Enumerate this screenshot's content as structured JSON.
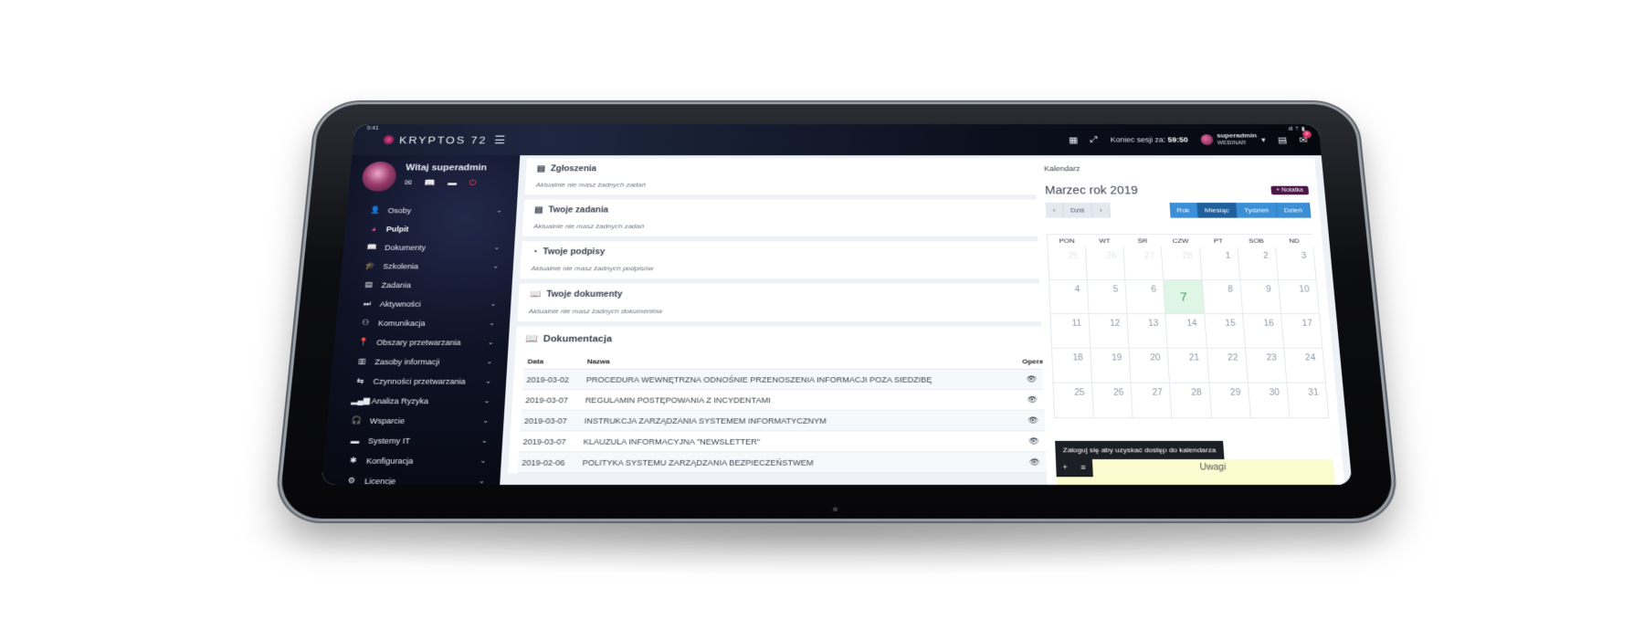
{
  "status": {
    "time": "9:41",
    "right": "ıll ⇡ ▮"
  },
  "topbar": {
    "logo": "KRYPTOS 72",
    "session_label": "Koniec sesji za:",
    "session_time": "59:50",
    "user_name": "superadmin",
    "user_sub": "WEBINAR",
    "mail_count": "0"
  },
  "sidebar": {
    "greeting": "Witaj superadmin",
    "items": [
      {
        "label": "Osoby",
        "icon": "user-icon",
        "glyph": "👤",
        "chevron": true
      },
      {
        "label": "Pulpit",
        "icon": "dashboard-icon",
        "glyph": "◕",
        "chevron": false,
        "active": true
      },
      {
        "label": "Dokumenty",
        "icon": "book-icon",
        "glyph": "📖",
        "chevron": true
      },
      {
        "label": "Szkolenia",
        "icon": "graduation-cap-icon",
        "glyph": "🎓",
        "chevron": true
      },
      {
        "label": "Zadania",
        "icon": "tasks-icon",
        "glyph": "▤",
        "chevron": false
      },
      {
        "label": "Aktywności",
        "icon": "activity-icon",
        "glyph": "⏭",
        "chevron": true
      },
      {
        "label": "Komunikacja",
        "icon": "communication-icon",
        "glyph": "⚇",
        "chevron": true
      },
      {
        "label": "Obszary przetwarzania",
        "icon": "map-marker-icon",
        "glyph": "📍",
        "chevron": true
      },
      {
        "label": "Zasoby informacji",
        "icon": "list-icon",
        "glyph": "▥",
        "chevron": true
      },
      {
        "label": "Czynności przetwarzania",
        "icon": "exchange-icon",
        "glyph": "⇆",
        "chevron": true
      },
      {
        "label": "Analiza Ryzyka",
        "icon": "bar-chart-icon",
        "glyph": "▂▄▆",
        "chevron": true
      },
      {
        "label": "Wsparcie",
        "icon": "headphones-icon",
        "glyph": "🎧",
        "chevron": true
      },
      {
        "label": "Systemy IT",
        "icon": "laptop-icon",
        "glyph": "▬",
        "chevron": true
      },
      {
        "label": "Konfiguracja",
        "icon": "gear-icon",
        "glyph": "✱",
        "chevron": true
      },
      {
        "label": "Licencje",
        "icon": "cogs-icon",
        "glyph": "⚙",
        "chevron": true
      }
    ]
  },
  "cards": [
    {
      "title": "Zgłoszenia",
      "empty": "Aktualnie nie masz żadnych zadań",
      "glyph": "▤"
    },
    {
      "title": "Twoje zadania",
      "empty": "Aktualnie nie masz żadnych zadań",
      "glyph": "▤"
    },
    {
      "title": "Twoje podpisy",
      "empty": "Aktualnie nie masz żadnych podpisów",
      "glyph": "◔"
    },
    {
      "title": "Twoje dokumenty",
      "empty": "Aktualnie nie masz żadnych dokumentów",
      "glyph": "📖"
    }
  ],
  "docs": {
    "title": "Dokumentacja",
    "columns": {
      "date": "Data",
      "name": "Nazwa",
      "ops": "Operacje"
    },
    "rows": [
      {
        "date": "2019-03-02",
        "name": "PROCEDURA WEWNĘTRZNA ODNOŚNIE PRZENOSZENIA INFORMACJI POZA SIEDZIBĘ"
      },
      {
        "date": "2019-03-07",
        "name": "REGULAMIN POSTĘPOWANIA Z INCYDENTAMI"
      },
      {
        "date": "2019-03-07",
        "name": "INSTRUKCJA ZARZĄDZANIA SYSTEMEM INFORMATYCZNYM"
      },
      {
        "date": "2019-03-07",
        "name": "KLAUZULA INFORMACYJNA \"NEWSLETTER\""
      },
      {
        "date": "2019-02-06",
        "name": "POLITYKA SYSTEMU ZARZĄDZANIA BEZPIECZEŃSTWEM"
      }
    ]
  },
  "calendar": {
    "title": "Kalendarz",
    "month": "Marzec rok 2019",
    "note_button": "+ Notatka",
    "today_button": "Dziś",
    "prev": "‹",
    "next": "›",
    "views": [
      "Rok",
      "Miesiąc",
      "Tydzień",
      "Dzień"
    ],
    "active_view": "Miesiąc",
    "weekdays": [
      "PON",
      "WT",
      "ŚR",
      "CZW",
      "PT",
      "SOB",
      "ND"
    ],
    "days": [
      {
        "n": "25",
        "other": true
      },
      {
        "n": "26",
        "other": true
      },
      {
        "n": "27",
        "other": true
      },
      {
        "n": "28",
        "other": true
      },
      {
        "n": "1"
      },
      {
        "n": "2"
      },
      {
        "n": "3"
      },
      {
        "n": "4"
      },
      {
        "n": "5"
      },
      {
        "n": "6"
      },
      {
        "n": "7",
        "today": true
      },
      {
        "n": "8"
      },
      {
        "n": "9"
      },
      {
        "n": "10"
      },
      {
        "n": "11"
      },
      {
        "n": "12"
      },
      {
        "n": "13"
      },
      {
        "n": "14"
      },
      {
        "n": "15"
      },
      {
        "n": "16"
      },
      {
        "n": "17"
      },
      {
        "n": "18"
      },
      {
        "n": "19"
      },
      {
        "n": "20"
      },
      {
        "n": "21"
      },
      {
        "n": "22"
      },
      {
        "n": "23"
      },
      {
        "n": "24"
      },
      {
        "n": "25"
      },
      {
        "n": "26"
      },
      {
        "n": "27"
      },
      {
        "n": "28"
      },
      {
        "n": "29"
      },
      {
        "n": "30"
      },
      {
        "n": "31"
      }
    ],
    "login_prompt": "Zaloguj się aby uzyskać dostęp do kalendarza",
    "notes_label": "Uwagi",
    "notes_add": "+",
    "notes_list": "≡"
  },
  "colors": {
    "brand": "#e34c8f",
    "accent_blue": "#3b8fd6",
    "note_button": "#4a1747"
  }
}
